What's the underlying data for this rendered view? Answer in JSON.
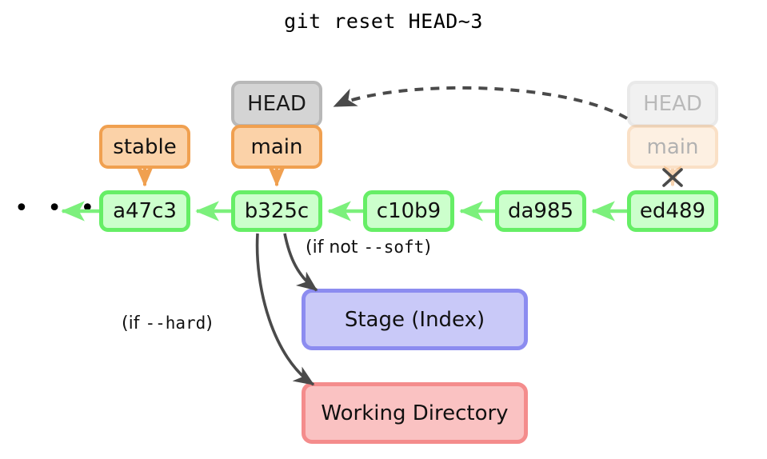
{
  "title": "git reset HEAD~3",
  "commits": [
    {
      "id": "a47c3"
    },
    {
      "id": "b325c"
    },
    {
      "id": "c10b9"
    },
    {
      "id": "da985"
    },
    {
      "id": "ed489"
    }
  ],
  "ellipsis": "• • •",
  "refs": {
    "head_label": "HEAD",
    "branch_main": "main",
    "branch_stable": "stable",
    "ghost_head_label": "HEAD",
    "ghost_main_label": "main",
    "detach_marker": "×"
  },
  "areas": {
    "stage": "Stage (Index)",
    "working_directory": "Working Directory"
  },
  "annotations": {
    "soft": {
      "prefix": "(if not ",
      "flag": "--soft",
      "suffix": ")"
    },
    "hard": {
      "prefix": "(if ",
      "flag": "--hard",
      "suffix": ")"
    }
  },
  "colors": {
    "commit_fill": "#ccffcc",
    "commit_border": "#66ee66",
    "head_fill": "#d4d4d4",
    "head_border": "#b8b8b8",
    "branch_fill": "#fbd2a8",
    "branch_border": "#f0a050",
    "stage_fill": "#c9c9f8",
    "stage_border": "#8c8cf0",
    "workdir_fill": "#fac2c2",
    "workdir_border": "#f48c8c",
    "arrow_dark": "#4a4a4a",
    "arrow_green": "#7cf07c",
    "arrow_orange": "#f0a050"
  }
}
